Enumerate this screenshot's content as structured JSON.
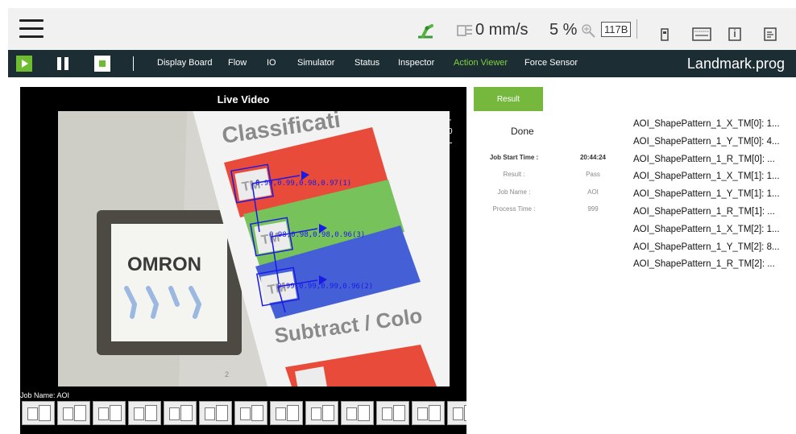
{
  "header": {
    "speed_value": "0 mm/s",
    "speed_percent": "5 %",
    "badge": "117B",
    "icons": [
      "menu-icon",
      "robot-arm-icon",
      "speed-gauge-icon",
      "zoom-icon",
      "controller-icon",
      "keyboard-icon",
      "info-icon",
      "notepad-icon"
    ]
  },
  "toolbar": {
    "tabs": [
      "Display Board",
      "Flow",
      "IO",
      "Simulator",
      "Status",
      "Inspector",
      "Action Viewer",
      "Force Sensor"
    ],
    "active_tab": "Action Viewer",
    "program_name": "Landmark.prog",
    "accent_color": "#6ebc2f"
  },
  "video": {
    "title": "Live Video",
    "zoom_plus": "+",
    "zoom_level": "x0",
    "zoom_minus": "−",
    "job_name_label": "Job Name: AOI",
    "scene_text": {
      "title_top": "Classificati",
      "logo": "OMRON",
      "title_bottom": "Subtract / Colo",
      "card_glyph": "TM",
      "small_num": "2"
    },
    "detections": [
      {
        "label": "0.99,0.99,0.98,0.97(1)"
      },
      {
        "label": "0.98,0.98,0.98,0.96(3)"
      },
      {
        "label": "0.99,0.99,0.99,0.96(2)"
      }
    ],
    "thumbnail_count": 13
  },
  "result_panel": {
    "button_label": "Result",
    "status": "Done",
    "info": [
      {
        "key": "Job Start Time :",
        "value": "20:44:24"
      },
      {
        "key": "Result :",
        "value": "Pass"
      },
      {
        "key": "Job Name :",
        "value": "AOI"
      },
      {
        "key": "Process Time :",
        "value": "999"
      }
    ],
    "results": [
      "AOI_ShapePattern_1_X_TM[0]: 1...",
      "AOI_ShapePattern_1_Y_TM[0]: 4...",
      "AOI_ShapePattern_1_R_TM[0]: ...",
      "AOI_ShapePattern_1_X_TM[1]: 1...",
      "AOI_ShapePattern_1_Y_TM[1]: 1...",
      "AOI_ShapePattern_1_R_TM[1]: ...",
      "AOI_ShapePattern_1_X_TM[2]: 1...",
      "AOI_ShapePattern_1_Y_TM[2]: 8...",
      "AOI_ShapePattern_1_R_TM[2]: ..."
    ]
  }
}
